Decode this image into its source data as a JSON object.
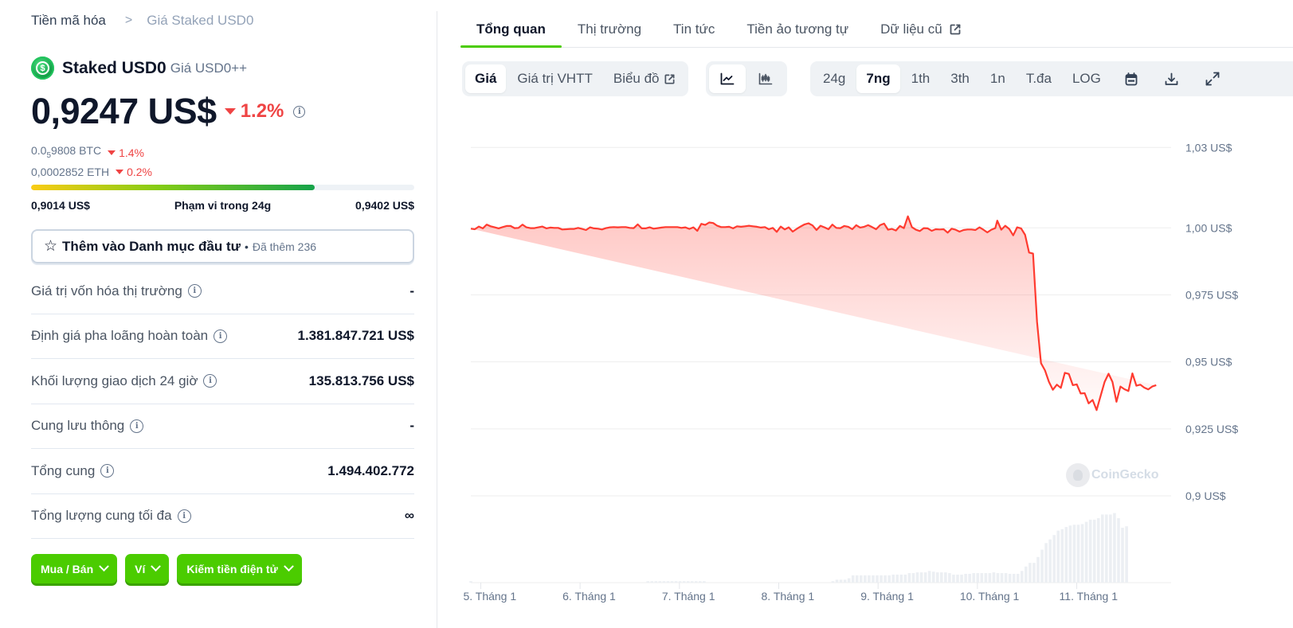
{
  "breadcrumb": {
    "root": "Tiền mã hóa",
    "separator": ">",
    "current": "Giá Staked USD0"
  },
  "coin": {
    "name": "Staked USD0",
    "symbol_label": "Giá USD0++",
    "logo_glyph": "$"
  },
  "price": {
    "value": "0,9247 US$",
    "change": "1.2%",
    "direction": "down",
    "btc_prefix": "0.0",
    "btc_zero_count": "5",
    "btc_rest": "9808 BTC",
    "btc_change": "1.4%",
    "eth_value": "0,0002852 ETH",
    "eth_change": "0.2%"
  },
  "range_24h": {
    "low": "0,9014 US$",
    "label": "Phạm vi trong 24g",
    "high": "0,9402 US$",
    "fill_fraction": 0.74
  },
  "watchlist": {
    "label": "Thêm vào Danh mục đầu tư",
    "dot": "•",
    "added": "Đã thêm 236",
    "icon": "star-icon"
  },
  "stats": [
    {
      "label": "Giá trị vốn hóa thị trường",
      "value": "-"
    },
    {
      "label": "Định giá pha loãng hoàn toàn",
      "value": "1.381.847.721 US$"
    },
    {
      "label": "Khối lượng giao dịch 24 giờ",
      "value": "135.813.756 US$"
    },
    {
      "label": "Cung lưu thông",
      "value": "-"
    },
    {
      "label": "Tổng cung",
      "value": "1.494.402.772"
    },
    {
      "label": "Tổng lượng cung tối đa",
      "value": "∞"
    }
  ],
  "actions": [
    {
      "label": "Mua / Bán"
    },
    {
      "label": "Ví"
    },
    {
      "label": "Kiếm tiền điện tử"
    }
  ],
  "tabs": [
    {
      "label": "Tổng quan",
      "active": true
    },
    {
      "label": "Thị trường"
    },
    {
      "label": "Tin tức"
    },
    {
      "label": "Tiền ảo tương tự"
    },
    {
      "label": "Dữ liệu cũ",
      "external": true
    }
  ],
  "toolbar": {
    "metric_tabs": [
      {
        "label": "Giá",
        "active": true
      },
      {
        "label": "Giá trị VHTT"
      },
      {
        "label": "Biểu đồ",
        "external": true
      }
    ],
    "chart_types": [
      {
        "icon": "line-chart-icon",
        "active": true
      },
      {
        "icon": "candlestick-icon"
      }
    ],
    "ranges": [
      {
        "label": "24g"
      },
      {
        "label": "7ng",
        "active": true
      },
      {
        "label": "1th"
      },
      {
        "label": "3th"
      },
      {
        "label": "1n"
      },
      {
        "label": "T.đa"
      },
      {
        "label": "LOG"
      }
    ],
    "tool_icons": [
      "calendar-icon",
      "download-icon",
      "expand-icon"
    ]
  },
  "colors": {
    "accent": "#4bcc00",
    "down": "#ef4444",
    "line": "#ff3b30"
  },
  "watermark": "CoinGecko",
  "chart_data": {
    "type": "area",
    "title": "",
    "xlabel": "",
    "ylabel": "",
    "x_ticks": [
      "5. Tháng 1",
      "6. Tháng 1",
      "7. Tháng 1",
      "8. Tháng 1",
      "9. Tháng 1",
      "10. Tháng 1",
      "11. Tháng 1"
    ],
    "y_ticks": [
      {
        "value": 1.03,
        "label": "1,03 US$"
      },
      {
        "value": 1.0,
        "label": "1,00 US$"
      },
      {
        "value": 0.975,
        "label": "0,975 US$"
      },
      {
        "value": 0.95,
        "label": "0,95 US$"
      },
      {
        "value": 0.925,
        "label": "0,925 US$"
      },
      {
        "value": 0.9,
        "label": "0,9 US$"
      }
    ],
    "ylim": [
      0.9,
      1.0375
    ],
    "grid": true,
    "x_range_days": [
      4.9,
      11.95
    ],
    "price_series": {
      "name": "Giá",
      "x": [
        4.9,
        4.94,
        4.98,
        5.02,
        5.06,
        5.1,
        5.14,
        5.18,
        5.22,
        5.26,
        5.3,
        5.34,
        5.38,
        5.42,
        5.46,
        5.5,
        5.54,
        5.58,
        5.62,
        5.66,
        5.7,
        5.74,
        5.78,
        5.82,
        5.86,
        5.9,
        5.94,
        5.98,
        6.02,
        6.06,
        6.1,
        6.14,
        6.18,
        6.22,
        6.26,
        6.3,
        6.34,
        6.38,
        6.42,
        6.46,
        6.5,
        6.54,
        6.58,
        6.62,
        6.66,
        6.7,
        6.74,
        6.78,
        6.82,
        6.86,
        6.9,
        6.94,
        6.98,
        7.02,
        7.06,
        7.1,
        7.14,
        7.18,
        7.22,
        7.26,
        7.3,
        7.34,
        7.38,
        7.42,
        7.46,
        7.5,
        7.54,
        7.58,
        7.62,
        7.66,
        7.7,
        7.74,
        7.78,
        7.82,
        7.86,
        7.9,
        7.94,
        7.98,
        8.02,
        8.06,
        8.1,
        8.14,
        8.18,
        8.22,
        8.26,
        8.3,
        8.34,
        8.38,
        8.42,
        8.46,
        8.5,
        8.54,
        8.58,
        8.62,
        8.66,
        8.7,
        8.74,
        8.78,
        8.82,
        8.86,
        8.9,
        8.94,
        8.98,
        9.02,
        9.06,
        9.1,
        9.14,
        9.18,
        9.22,
        9.26,
        9.3,
        9.34,
        9.38,
        9.42,
        9.46,
        9.5,
        9.54,
        9.58,
        9.62,
        9.66,
        9.7,
        9.74,
        9.78,
        9.82,
        9.86,
        9.9,
        9.94,
        9.98,
        10.02,
        10.06,
        10.1,
        10.14,
        10.18,
        10.2,
        10.24,
        10.28,
        10.32,
        10.36,
        10.4,
        10.44,
        10.48,
        10.52,
        10.56,
        10.6,
        10.64,
        10.68,
        10.72,
        10.76,
        10.8,
        10.84,
        10.88,
        10.92,
        10.96,
        11.0,
        11.04,
        11.08,
        11.12,
        11.16,
        11.2,
        11.24,
        11.28,
        11.32,
        11.36,
        11.4,
        11.44,
        11.48,
        11.52,
        11.56,
        11.6,
        11.64,
        11.68,
        11.72,
        11.76,
        11.8,
        11.84,
        11.88,
        11.92,
        11.95
      ],
      "values": [
        0.9997,
        0.9995,
        1.0005,
        0.9998,
        1.0012,
        1.0006,
        1.0002,
        0.9998,
        1.0003,
        1.0007,
        1.0007,
        0.9999,
        1.0,
        1.0012,
        1.0002,
        0.9999,
        0.9999,
        1.0002,
        1.0005,
        0.9998,
        1.0001,
        1.0,
        1.0,
        0.9994,
        0.9995,
        0.9996,
        0.9996,
        1.0,
        0.9996,
        0.9992,
        1.0002,
        0.9998,
        0.9997,
        0.9994,
        0.9999,
        1.0002,
        1.0003,
        1.0002,
        1.0003,
        1.0003,
        1.0,
        0.9999,
        1.0013,
        0.9998,
        0.9998,
        1.0002,
        0.9997,
        0.9999,
        1.0001,
        1.0003,
        1.0003,
        1.0003,
        1.0003,
        1.0,
        1.0002,
        0.9996,
        1.0002,
        0.9989,
        1.0015,
        1.0011,
        1.002,
        1.0018,
        1.0008,
        1.0003,
        1.0003,
        1.0004,
        0.9998,
        1.0006,
        1.0004,
        1.0006,
        1.0008,
        1.0006,
        1.0004,
        1.0001,
        1.0003,
        0.9995,
        1.0,
        0.9985,
        1.0005,
        0.9994,
        1.0002,
        0.9986,
        0.9996,
        1.0005,
        1.0013,
        1.0017,
        1.0009,
        0.9992,
        1.0008,
        1.0002,
        0.9995,
        1.0012,
        1.0,
        0.9999,
        1.0007,
        1.0004,
        0.9995,
        1.001,
        1.0001,
        1.0004,
        1.001,
        1.0003,
        0.9995,
        1.001,
        1.0016,
        0.9993,
        0.9996,
        0.999,
        1.0007,
        0.9999,
        1.0043,
        1.0003,
        0.9993,
        0.9988,
        0.9999,
        0.9998,
        0.9989,
        0.9995,
        0.9994,
        0.9995,
        0.9982,
        0.9997,
        0.9993,
        0.9986,
        0.9992,
        0.9994,
        0.9994,
        0.9992,
        1.0002,
        0.9993,
        0.9983,
        0.9993,
        0.9999,
        1.0027,
        0.9993,
        1.0008,
        0.9996,
        0.9972,
        1.0002,
        0.9998,
        0.9974,
        0.9908,
        0.9904,
        0.965,
        0.9495,
        0.9468,
        0.9426,
        0.9396,
        0.9415,
        0.9403,
        0.9459,
        0.9455,
        0.9413,
        0.9416,
        0.9382,
        0.9383,
        0.9345,
        0.9358,
        0.932,
        0.9373,
        0.9425,
        0.9456,
        0.9425,
        0.9351,
        0.9408,
        0.9398,
        0.9391,
        0.9457,
        0.9411,
        0.9415,
        0.9404,
        0.9397,
        0.9408,
        0.9413
      ]
    },
    "volume_series": {
      "name": "Khối lượng",
      "relative": true,
      "x_start": 4.9,
      "x_step": 0.0405,
      "values": [
        0.02,
        0,
        0,
        0,
        0,
        0,
        0,
        0,
        0,
        0,
        0,
        0,
        0,
        0,
        0,
        0,
        0,
        0,
        0,
        0,
        0,
        0,
        0,
        0,
        0,
        0,
        0,
        0,
        0,
        0,
        0,
        0,
        0,
        0,
        0,
        0,
        0,
        0,
        0,
        0,
        0,
        0,
        0,
        0,
        0.02,
        0.02,
        0.02,
        0.02,
        0.02,
        0.02,
        0.02,
        0.02,
        0.02,
        0.02,
        0.02,
        0.02,
        0.02,
        0.02,
        0.02,
        0,
        0,
        0,
        0,
        0,
        0,
        0,
        0,
        0,
        0,
        0,
        0,
        0,
        0,
        0,
        0,
        0,
        0,
        0,
        0,
        0,
        0,
        0,
        0,
        0,
        0,
        0,
        0,
        0,
        0,
        0,
        0.02,
        0.04,
        0.04,
        0.04,
        0.06,
        0.1,
        0.1,
        0.1,
        0.1,
        0.1,
        0.1,
        0.1,
        0.1,
        0.1,
        0.1,
        0.11,
        0.11,
        0.11,
        0.11,
        0.13,
        0.13,
        0.14,
        0.14,
        0.14,
        0.16,
        0.15,
        0.14,
        0.14,
        0.14,
        0.13,
        0.11,
        0.11,
        0.11,
        0.12,
        0.12,
        0.13,
        0.13,
        0.13,
        0.13,
        0.13,
        0.14,
        0.13,
        0.13,
        0.13,
        0.12,
        0.12,
        0.12,
        0.16,
        0.22,
        0.27,
        0.27,
        0.35,
        0.45,
        0.54,
        0.59,
        0.65,
        0.71,
        0.73,
        0.76,
        0.78,
        0.79,
        0.79,
        0.8,
        0.83,
        0.86,
        0.86,
        0.88,
        0.93,
        0.93,
        0.93,
        0.95,
        0.88,
        0.75,
        0.77
      ]
    }
  }
}
